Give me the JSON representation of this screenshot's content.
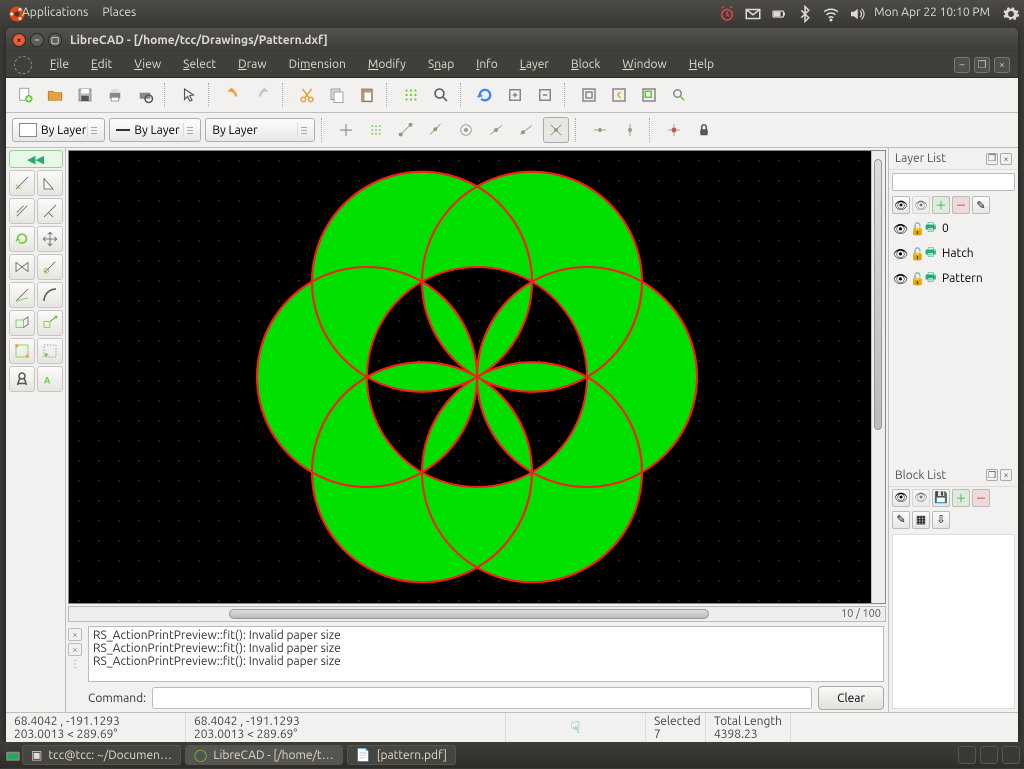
{
  "topbar": {
    "apps": "Applications",
    "places": "Places",
    "clock": "Mon Apr 22  10:10 PM"
  },
  "window": {
    "title": "LibreCAD - [/home/tcc/Drawings/Pattern.dxf]"
  },
  "menu": [
    "File",
    "Edit",
    "View",
    "Select",
    "Draw",
    "Dimension",
    "Modify",
    "Snap",
    "Info",
    "Layer",
    "Block",
    "Window",
    "Help"
  ],
  "combos": {
    "color": "By Layer",
    "line": "By Layer",
    "width": "By Layer"
  },
  "zoom": "10 / 100",
  "panels": {
    "layer_title": "Layer List",
    "block_title": "Block List",
    "layers": [
      {
        "name": "0"
      },
      {
        "name": "Hatch"
      },
      {
        "name": "Pattern"
      }
    ]
  },
  "log": [
    "RS_ActionPrintPreview::fit(): Invalid paper size",
    "RS_ActionPrintPreview::fit(): Invalid paper size",
    "RS_ActionPrintPreview::fit(): Invalid paper size"
  ],
  "command": {
    "label": "Command:",
    "clear": "Clear"
  },
  "status": {
    "abs1": "68.4042 , -191.1293",
    "rel1": "203.0013 < 289.69°",
    "abs2": "68.4042 , -191.1293",
    "rel2": "203.0013 < 289.69°",
    "sel_label": "Selected",
    "sel_val": "7",
    "len_label": "Total Length",
    "len_val": "4398.23"
  },
  "tasks": [
    {
      "label": "tcc@tcc: ~/Documen…"
    },
    {
      "label": "LibreCAD - [/home/t…"
    },
    {
      "label": "[pattern.pdf]"
    }
  ]
}
